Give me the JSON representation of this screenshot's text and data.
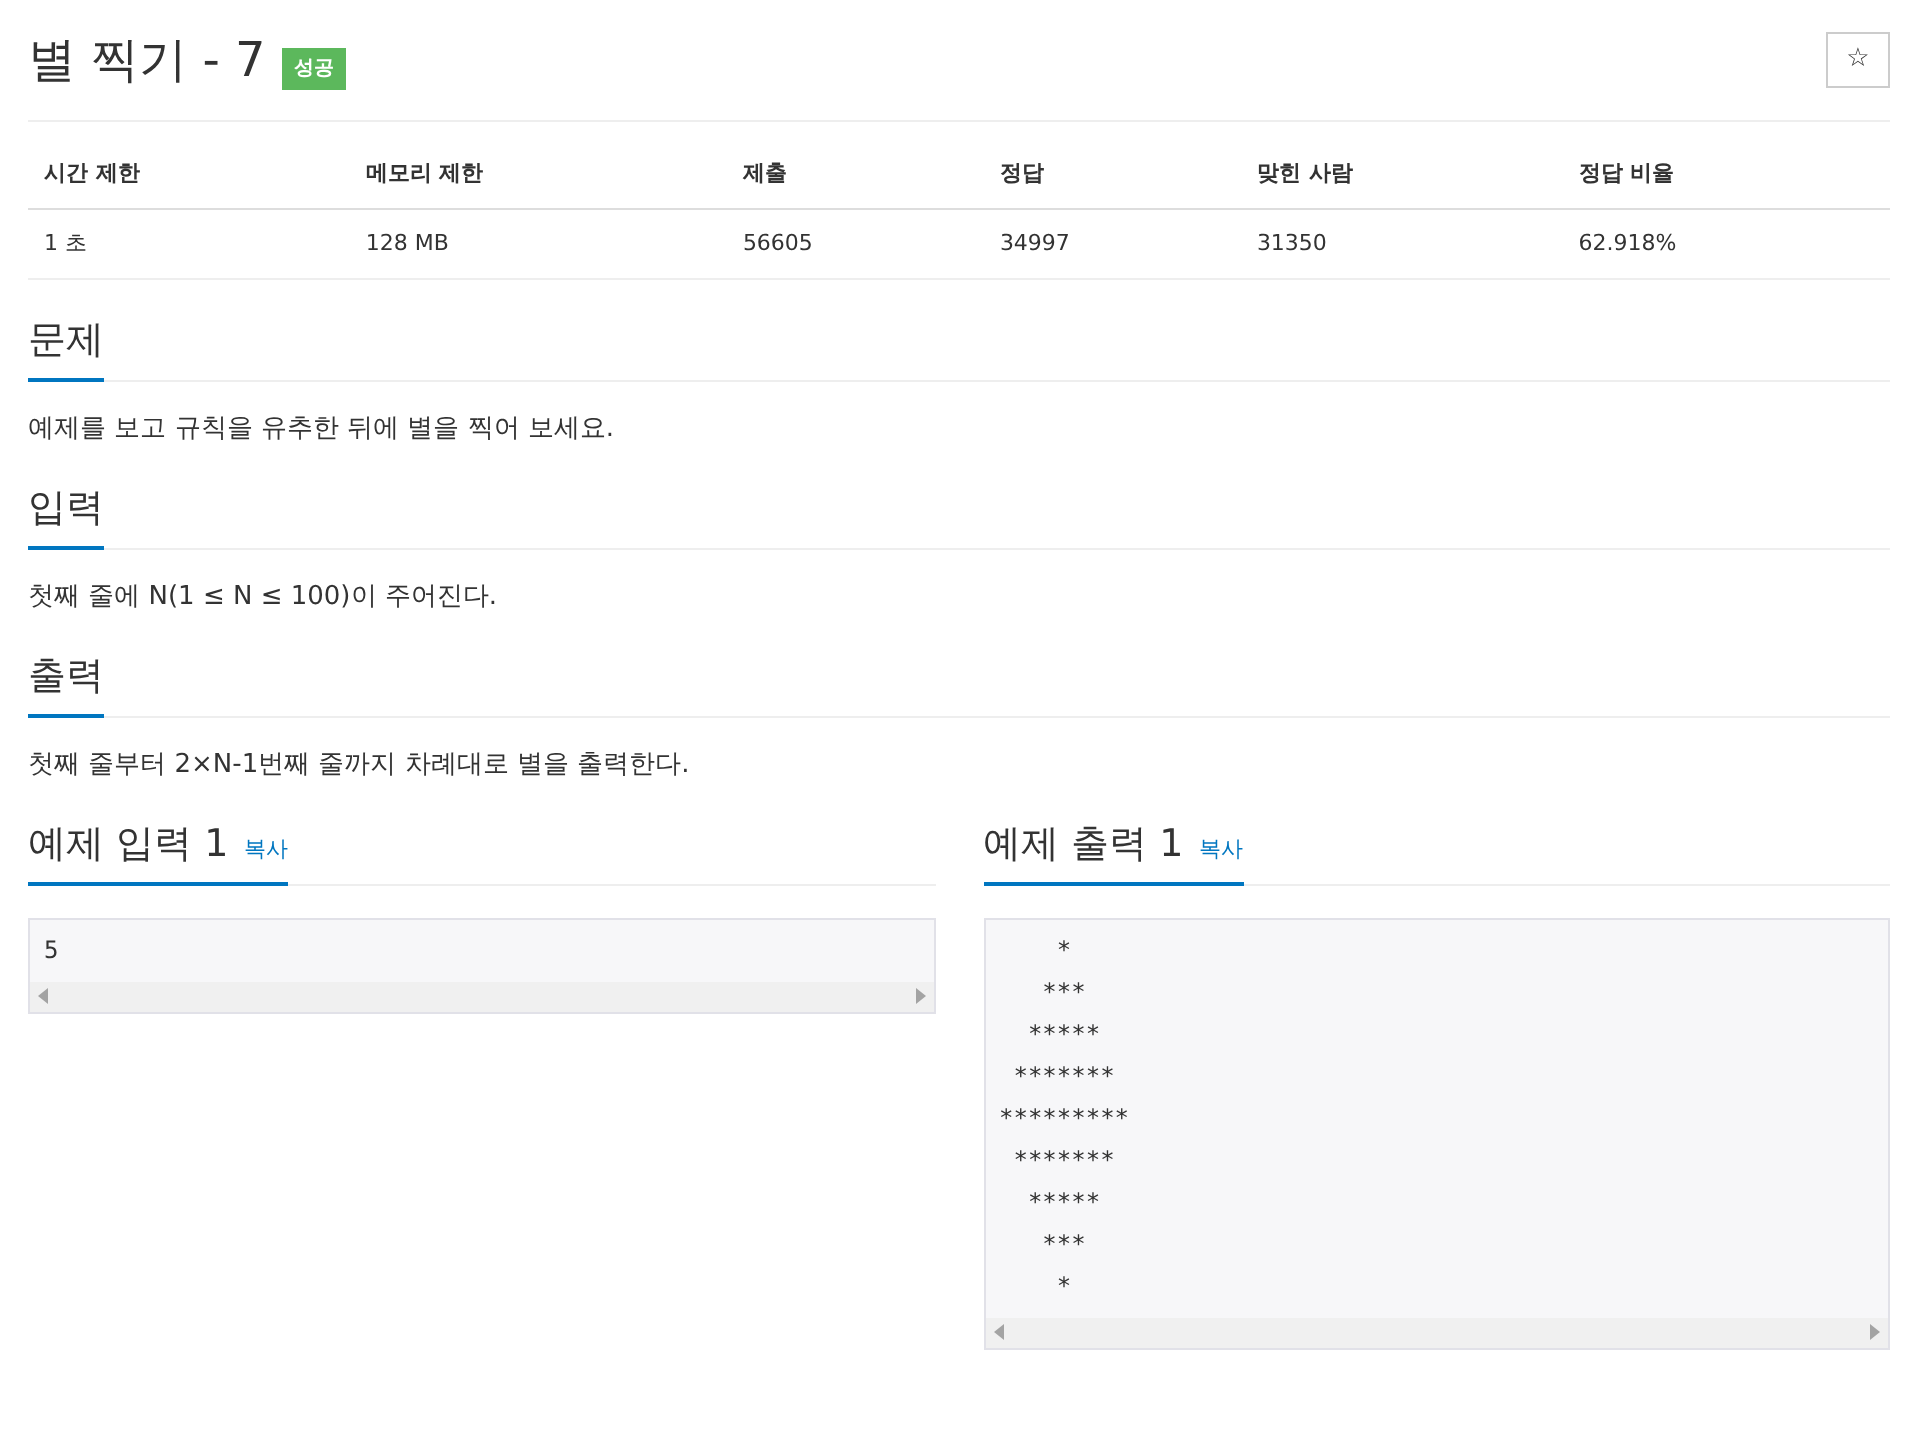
{
  "title": "별 찍기 - 7",
  "badge": "성공",
  "star_button": "☆",
  "info_table": {
    "columns": [
      "시간 제한",
      "메모리 제한",
      "제출",
      "정답",
      "맞힌 사람",
      "정답 비율"
    ],
    "rows": [
      [
        "1 초",
        "128 MB",
        "56605",
        "34997",
        "31350",
        "62.918%"
      ]
    ]
  },
  "sections": [
    {
      "heading": "문제",
      "text": "예제를 보고 규칙을 유추한 뒤에 별을 찍어 보세요."
    },
    {
      "heading": "입력",
      "text": "첫째 줄에 N(1 ≤ N ≤ 100)이 주어진다."
    },
    {
      "heading": "출력",
      "text": "첫째 줄부터 2×N-1번째 줄까지 차례대로 별을 출력한다."
    }
  ],
  "samples": [
    {
      "heading": "예제 입력 1",
      "copy": "복사",
      "code": "5"
    },
    {
      "heading": "예제 출력 1",
      "copy": "복사",
      "code": "    *\n   ***\n  *****\n *******\n*********\n *******\n  *****\n   ***\n    *"
    }
  ]
}
